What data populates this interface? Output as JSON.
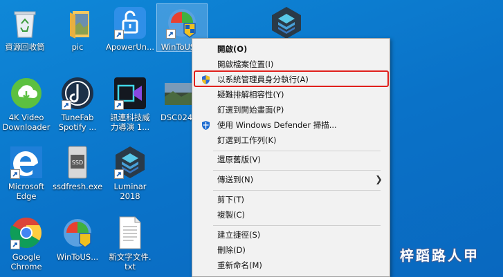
{
  "desktop": {
    "icons": [
      {
        "label": "資源回收筒",
        "icon": "recycle-bin-icon"
      },
      {
        "label": "pic",
        "icon": "folder-icon"
      },
      {
        "label": "ApowerUn...",
        "icon": "apowerunlock-icon"
      },
      {
        "label": "WinToUS...",
        "icon": "wintousb-icon"
      },
      {
        "label": "",
        "icon": "luminar-icon"
      },
      {
        "label": "4K Video",
        "label2": "Downloader",
        "icon": "4k-video-downloader-icon"
      },
      {
        "label": "TuneFab",
        "label2": "Spotify ...",
        "icon": "tunefab-icon"
      },
      {
        "label": "訊連科技威",
        "label2": "力導演 1...",
        "icon": "powerdirector-icon"
      },
      {
        "label": "DSC024",
        "icon": "photo-icon"
      },
      {
        "label": "Microsoft",
        "label2": "Edge",
        "icon": "edge-icon"
      },
      {
        "label": "ssdfresh.exe",
        "icon": "ssd-icon"
      },
      {
        "label": "Luminar",
        "label2": "2018",
        "icon": "luminar-icon"
      },
      {
        "label": "Google",
        "label2": "Chrome",
        "icon": "chrome-icon"
      },
      {
        "label": "WinToUS...",
        "icon": "wintousb-icon"
      },
      {
        "label": "新文字文件.",
        "label2": "txt",
        "icon": "text-file-icon"
      }
    ]
  },
  "context_menu": {
    "items": [
      {
        "label": "開啟(O)",
        "bold": true
      },
      {
        "label": "開啟檔案位置(I)"
      },
      {
        "label": "以系統管理員身分執行(A)",
        "icon": "uac-shield-icon"
      },
      {
        "label": "疑難排解相容性(Y)"
      },
      {
        "label": "釘選到開始畫面(P)"
      },
      {
        "label": "使用 Windows Defender 掃描...",
        "icon": "windows-defender-icon"
      },
      {
        "label": "釘選到工作列(K)"
      },
      {
        "label": "還原舊版(V)"
      },
      {
        "label": "傳送到(N)",
        "submenu": true
      },
      {
        "label": "剪下(T)"
      },
      {
        "label": "複製(C)"
      },
      {
        "label": "建立捷徑(S)"
      },
      {
        "label": "刪除(D)"
      },
      {
        "label": "重新命名(M)"
      }
    ]
  },
  "watermark": "梓蹈路人甲",
  "colors": {
    "desktop_bg": "#0a72c8",
    "highlight_border": "#e0201c",
    "menu_bg": "#f2f2f2"
  }
}
